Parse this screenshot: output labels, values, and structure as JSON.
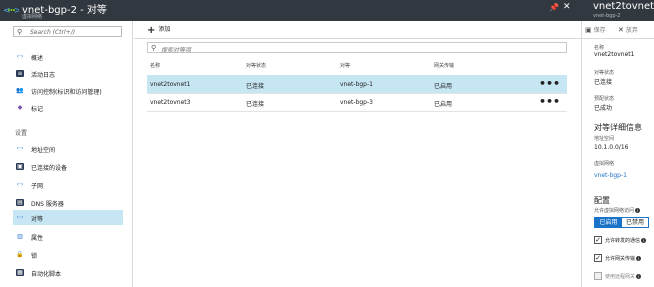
{
  "header": {
    "title": "vnet-bgp-2 - 对等",
    "subtitle": "虚拟网络",
    "pin_icon": "pin-icon",
    "close_icon": "close-icon",
    "right_title": "vnet2tovnet1",
    "right_subtitle": "vnet-bgp-2"
  },
  "sidebar": {
    "search_placeholder": "Search (Ctrl+/)",
    "items_top": [
      {
        "label": "概述",
        "icon": "overview-icon"
      },
      {
        "label": "活动日志",
        "icon": "activity-log-icon"
      },
      {
        "label": "访问控制(标识和访问管理)",
        "icon": "access-control-icon"
      },
      {
        "label": "标记",
        "icon": "tag-icon"
      }
    ],
    "section_label": "设置",
    "items_settings": [
      {
        "label": "地址空间",
        "icon": "address-space-icon"
      },
      {
        "label": "已连接的设备",
        "icon": "connected-devices-icon"
      },
      {
        "label": "子网",
        "icon": "subnets-icon"
      },
      {
        "label": "DNS 服务器",
        "icon": "dns-icon"
      },
      {
        "label": "对等",
        "icon": "peering-icon"
      },
      {
        "label": "属性",
        "icon": "properties-icon"
      },
      {
        "label": "锁",
        "icon": "lock-icon"
      },
      {
        "label": "自动化脚本",
        "icon": "automation-script-icon"
      }
    ]
  },
  "main": {
    "add_label": "添加",
    "filter_placeholder": "搜索对等项",
    "columns": [
      "名称",
      "对等状态",
      "对等",
      "网关传输"
    ],
    "rows": [
      {
        "name": "vnet2tovnet1",
        "status": "已连接",
        "peer": "vnet-bgp-1",
        "gateway": "已启用",
        "more": "•••"
      },
      {
        "name": "vnet2tovnet3",
        "status": "已连接",
        "peer": "vnet-bgp-3",
        "gateway": "已启用",
        "more": "•••"
      }
    ]
  },
  "details": {
    "save_label": "保存",
    "discard_label": "放弃",
    "name_label": "名称",
    "name_value": "vnet2tovnet1",
    "peering_status_label": "对等状态",
    "peering_status_value": "已连接",
    "provisioning_label": "预配状态",
    "provisioning_value": "已成功",
    "peer_details_heading": "对等详细信息",
    "address_space_label": "地址空间",
    "address_space_value": "10.1.0.0/16",
    "vnet_label": "虚拟网络",
    "vnet_value": "vnet-bgp-1",
    "config_heading": "配置",
    "allow_access_label": "允许虚拟网络访问",
    "toggle_on": "已启用",
    "toggle_off": "已禁用",
    "check_forwarded_label": "允许转发的通信",
    "check_gateway_label": "允许网关传输",
    "check_remote_label": "使用远程网关",
    "check_mark": "✓"
  },
  "colors": {
    "header_bg": "#32383f",
    "selected_row": "#c7e6f4",
    "accent_blue": "#1a73c8"
  }
}
